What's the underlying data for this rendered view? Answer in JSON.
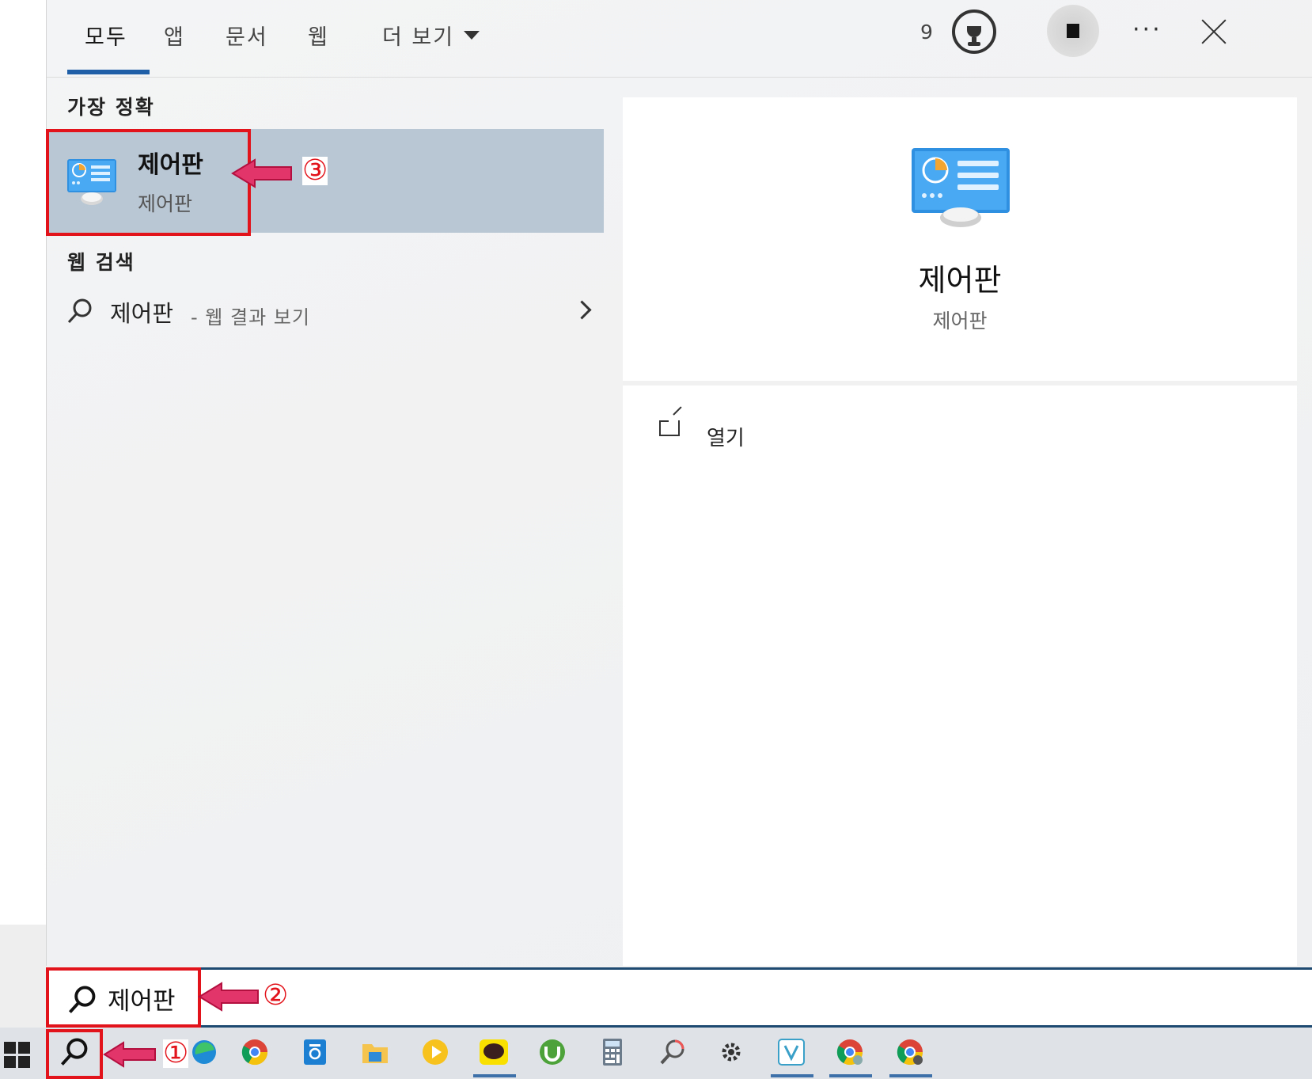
{
  "tabs": [
    {
      "label": "모두"
    },
    {
      "label": "앱"
    },
    {
      "label": "문서"
    },
    {
      "label": "웹"
    },
    {
      "label": "더 보기"
    }
  ],
  "header": {
    "badge_count": "9"
  },
  "best_match": {
    "section_label": "가장 정확",
    "title": "제어판",
    "subtitle": "제어판"
  },
  "web_search": {
    "section_label": "웹 검색",
    "query": "제어판",
    "hint": "- 웹 결과 보기"
  },
  "preview": {
    "title": "제어판",
    "subtitle": "제어판",
    "actions": [
      {
        "label": "열기",
        "icon": "open-icon"
      }
    ]
  },
  "search_box": {
    "value": "제어판"
  },
  "annotations": {
    "step1": "①",
    "step2": "②",
    "step3": "③"
  },
  "taskbar_icons": [
    "windows-start-icon",
    "search-icon",
    "task-view-icon",
    "edge-icon",
    "chrome-icon",
    "hangul-icon",
    "file-explorer-icon",
    "media-player-icon",
    "kakaotalk-icon",
    "utorrent-icon",
    "calculator-icon",
    "search-tool-icon",
    "settings-gear-icon",
    "vivaldi-icon",
    "chrome-profile-icon",
    "chrome-alt-icon"
  ],
  "colors": {
    "accent": "#1f5fa8",
    "highlight": "#b9c6d3",
    "annotation": "#e3131b"
  }
}
